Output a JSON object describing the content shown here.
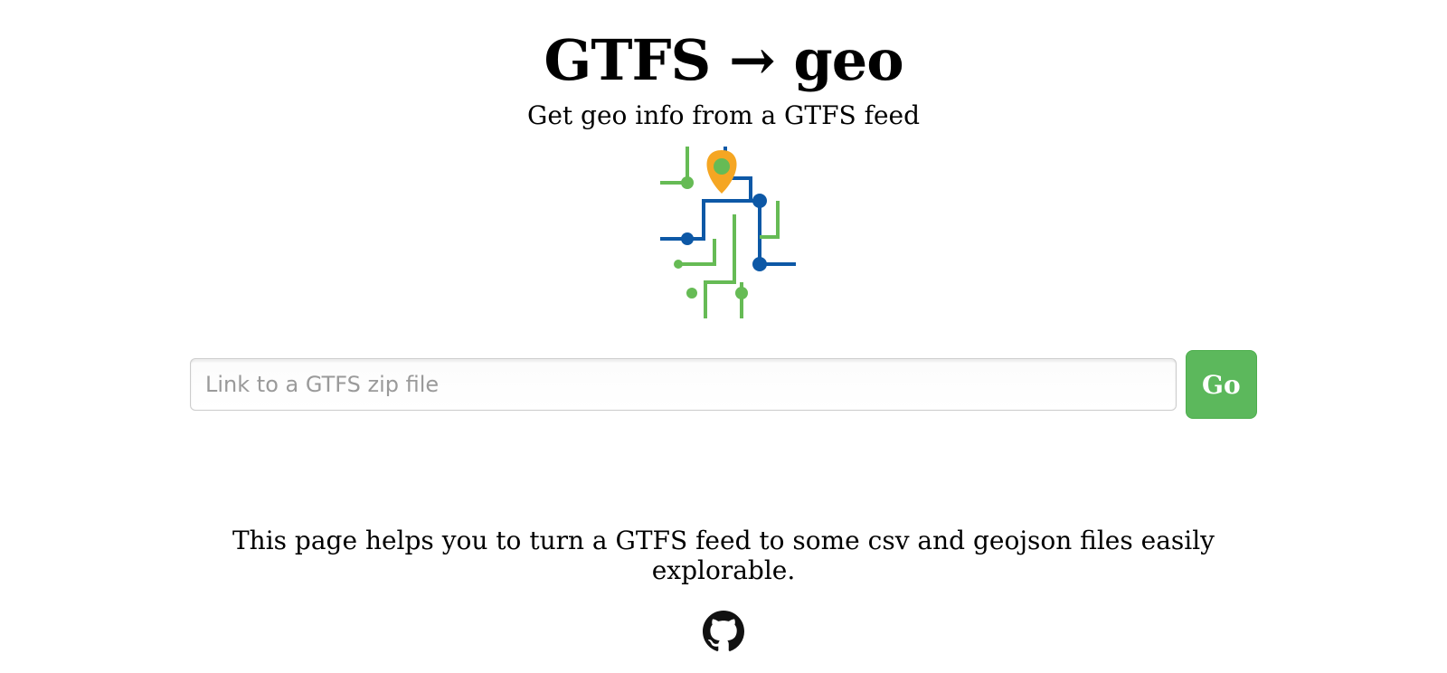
{
  "header": {
    "title": "GTFS → geo",
    "subtitle": "Get geo info from a GTFS feed"
  },
  "form": {
    "url_placeholder": "Link to a GTFS zip file",
    "url_value": "",
    "go_label": "Go"
  },
  "body": {
    "description": "This page helps you to turn a GTFS feed to some csv and geojson files easily explorable."
  },
  "icons": {
    "logo": "transit-map-icon",
    "github": "github-icon"
  },
  "colors": {
    "go_button": "#5cb85c",
    "logo_blue": "#0d58a6",
    "logo_green": "#66bb55",
    "logo_orange": "#f5a623"
  }
}
